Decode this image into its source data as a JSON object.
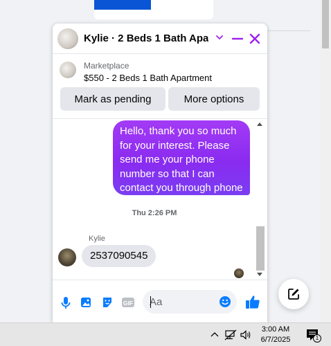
{
  "chat": {
    "title": "Kylie · 2 Beds 1 Bath Apart...",
    "marketplace_label": "Marketplace",
    "listing": "$550 - 2 Beds 1 Bath Apartment",
    "buttons": {
      "pending": "Mark as pending",
      "more": "More options"
    },
    "messages": {
      "outgoing": "Hello, thank you so much for your interest. Please send me your phone number so that I can contact you through phone",
      "timestamp": "Thu 2:26 PM",
      "sender": "Kylie",
      "incoming": "2537090545"
    },
    "composer": {
      "placeholder": "Aa",
      "gif_label": "GIF"
    },
    "colors": {
      "accent": "#a020f0",
      "outgoing_bubble": "#8a2bf0",
      "messenger_blue": "#0a7cff"
    }
  },
  "taskbar": {
    "time": "3:00 AM",
    "date": "6/7/2025",
    "notification_count": "1"
  }
}
